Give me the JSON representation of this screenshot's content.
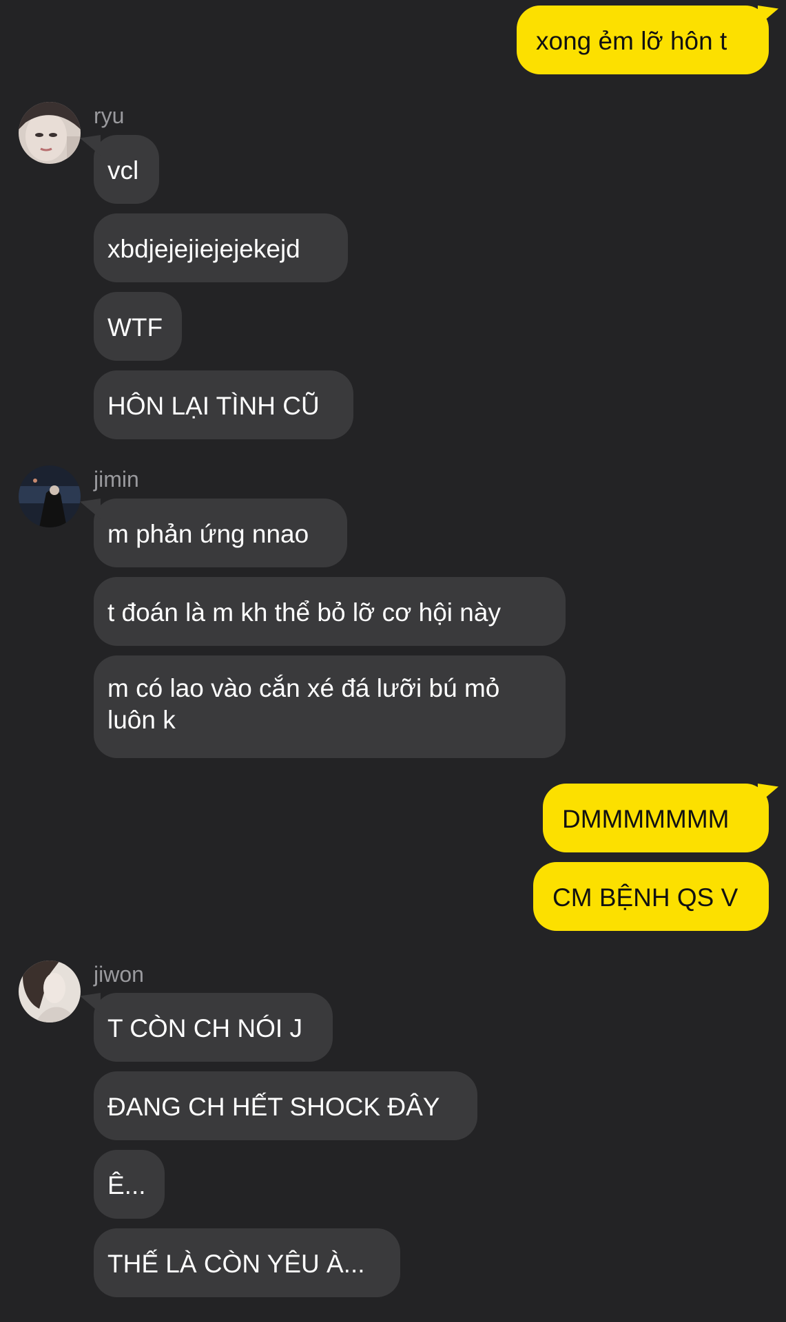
{
  "colors": {
    "background": "#232325",
    "incoming_bubble": "#3a3a3c",
    "outgoing_bubble": "#fce000",
    "sender_name": "#9a9a9e"
  },
  "messages": {
    "m1": "xong ẻm lỡ hôn t",
    "ryu_name": "ryu",
    "ryu_1": "vcl",
    "ryu_2": "xbdjejejiejejekejd",
    "ryu_3": "WTF",
    "ryu_4": "HÔN LẠI TÌNH CŨ",
    "jimin_name": "jimin",
    "jimin_1": "m phản ứng nnao",
    "jimin_2": "t đoán là m kh thể bỏ lỡ cơ hội này",
    "jimin_3": "m có lao vào cắn xé đá lưỡi bú mỏ luôn k",
    "m2": "DMMMMMMM",
    "m3": "CM BỆNH QS V",
    "jiwon_name": "jiwon",
    "jiwon_1": "T CÒN CH NÓI J",
    "jiwon_2": "ĐANG CH HẾT SHOCK ĐÂY",
    "jiwon_3": "Ê...",
    "jiwon_4": "THẾ LÀ CÒN YÊU À..."
  }
}
